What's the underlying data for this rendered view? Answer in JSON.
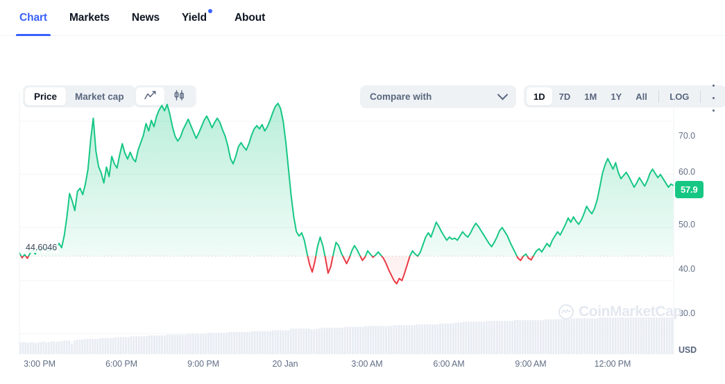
{
  "tabs": [
    {
      "label": "Chart",
      "active": true,
      "dot": false
    },
    {
      "label": "Markets",
      "active": false,
      "dot": false
    },
    {
      "label": "News",
      "active": false,
      "dot": false
    },
    {
      "label": "Yield",
      "active": false,
      "dot": true
    },
    {
      "label": "About",
      "active": false,
      "dot": false
    }
  ],
  "toolbar": {
    "metric": {
      "price": "Price",
      "market_cap": "Market cap",
      "selected": "Price"
    },
    "chart_type": {
      "line_icon": "line-chart-icon",
      "candle_icon": "candlestick-icon",
      "selected": "line"
    },
    "compare": {
      "label": "Compare with",
      "icon": "chevron-down-icon"
    },
    "ranges": [
      "1D",
      "7D",
      "1M",
      "1Y",
      "All"
    ],
    "range_selected": "1D",
    "log_label": "LOG",
    "more_icon": "ellipsis-icon"
  },
  "chart_data": {
    "type": "area",
    "title": "",
    "xlabel": "",
    "ylabel": "USD",
    "currency": "USD",
    "ylim": [
      26.0,
      75.5
    ],
    "yticks": [
      70.0,
      60.0,
      50.0,
      40.0,
      30.0
    ],
    "ytick_labels": [
      "70.0",
      "60.0",
      "50.0",
      "40.0",
      "30.0"
    ],
    "xtick_labels": [
      "3:00 PM",
      "6:00 PM",
      "9:00 PM",
      "20 Jan",
      "3:00 AM",
      "6:00 AM",
      "9:00 AM",
      "12:00 PM"
    ],
    "grid": true,
    "legend": null,
    "reference_line": {
      "value": 44.6046,
      "label": "44.6046",
      "style": "dotted"
    },
    "current_price": {
      "value": 57.9,
      "label": "57.9",
      "color": "#16c784"
    },
    "line_color_up": "#16c784",
    "line_color_down": "#ea3943",
    "watermark": "CoinMarketCap",
    "series": [
      {
        "name": "Price",
        "values": [
          45.2,
          44.3,
          44.9,
          44.2,
          45.1,
          45.8,
          45.0,
          46.2,
          45.4,
          46.4,
          45.9,
          45.5,
          46.1,
          45.7,
          46.3,
          47.0,
          46.2,
          48.5,
          52.0,
          56.4,
          55.0,
          53.2,
          56.8,
          57.4,
          56.2,
          58.2,
          61.0,
          66.5,
          70.6,
          64.4,
          61.5,
          60.3,
          58.4,
          61.4,
          59.6,
          63.4,
          62.0,
          61.2,
          63.7,
          65.8,
          64.0,
          62.9,
          64.2,
          63.0,
          62.4,
          64.6,
          66.0,
          67.4,
          69.6,
          68.2,
          70.2,
          69.0,
          71.0,
          72.2,
          73.0,
          72.0,
          73.2,
          71.4,
          69.0,
          67.2,
          66.3,
          67.0,
          68.4,
          69.4,
          70.4,
          69.2,
          68.0,
          66.8,
          67.8,
          69.0,
          70.2,
          71.0,
          70.0,
          68.8,
          69.8,
          70.6,
          69.8,
          68.4,
          67.2,
          65.4,
          63.0,
          62.0,
          63.4,
          65.2,
          66.0,
          65.2,
          64.6,
          65.8,
          67.4,
          68.6,
          69.2,
          68.6,
          69.4,
          68.2,
          69.0,
          70.2,
          71.6,
          72.8,
          73.4,
          72.4,
          70.0,
          66.0,
          61.0,
          56.0,
          52.0,
          49.2,
          48.4,
          49.0,
          47.6,
          45.2,
          43.0,
          41.6,
          43.6,
          46.4,
          48.2,
          46.6,
          44.2,
          41.4,
          42.6,
          45.0,
          47.2,
          46.6,
          45.2,
          44.2,
          43.2,
          44.2,
          45.6,
          46.6,
          45.8,
          44.8,
          43.8,
          44.4,
          45.6,
          45.0,
          44.4,
          44.8,
          45.4,
          44.8,
          44.2,
          43.2,
          42.0,
          41.0,
          40.0,
          39.4,
          40.4,
          40.0,
          41.4,
          43.0,
          44.6,
          45.6,
          45.0,
          44.6,
          45.4,
          46.8,
          48.2,
          49.0,
          48.2,
          49.6,
          51.0,
          50.2,
          49.2,
          48.4,
          47.6,
          48.2,
          47.8,
          48.0,
          47.6,
          48.4,
          49.2,
          48.6,
          48.2,
          49.0,
          50.0,
          50.8,
          50.2,
          49.4,
          48.6,
          47.8,
          47.0,
          46.4,
          47.2,
          48.2,
          49.4,
          50.0,
          49.2,
          48.4,
          47.2,
          46.2,
          45.2,
          44.2,
          43.8,
          44.6,
          45.0,
          44.2,
          43.9,
          44.8,
          45.6,
          46.0,
          45.4,
          46.2,
          47.0,
          46.4,
          47.6,
          48.4,
          49.2,
          48.6,
          49.6,
          50.6,
          51.8,
          51.0,
          52.0,
          51.2,
          50.6,
          51.4,
          52.6,
          54.0,
          53.2,
          52.6,
          53.6,
          55.2,
          57.6,
          60.2,
          61.8,
          63.0,
          62.0,
          61.0,
          62.2,
          60.4,
          59.2,
          59.8,
          60.4,
          59.6,
          58.6,
          57.6,
          58.4,
          59.4,
          58.6,
          57.8,
          58.8,
          60.2,
          61.0,
          60.2,
          59.4,
          60.0,
          59.2,
          58.4,
          57.6,
          58.2,
          57.9
        ]
      }
    ],
    "volume": {
      "name": "Volume",
      "color": "#e8ecf3",
      "values": [
        14,
        14,
        14,
        13,
        14,
        14,
        13,
        14,
        14,
        15,
        14,
        14,
        15,
        15,
        14,
        15,
        15,
        16,
        16,
        16,
        12,
        16,
        17,
        17,
        17,
        18,
        18,
        18,
        18,
        18,
        18,
        19,
        19,
        19,
        19,
        19,
        19,
        20,
        20,
        20,
        20,
        20,
        20,
        21,
        21,
        21,
        21,
        21,
        21,
        21,
        22,
        22,
        22,
        22,
        22,
        22,
        22,
        23,
        23,
        23,
        23,
        23,
        23,
        23,
        23,
        24,
        24,
        24,
        24,
        24,
        24,
        24,
        24,
        25,
        25,
        25,
        25,
        25,
        25,
        25,
        25,
        26,
        26,
        26,
        26,
        26,
        26,
        26,
        26,
        26,
        27,
        27,
        27,
        27,
        27,
        27,
        27,
        27,
        28,
        28,
        28,
        28,
        28,
        28,
        28,
        30,
        30,
        30,
        30,
        30,
        30,
        30,
        30,
        29,
        29,
        30,
        30,
        31,
        31,
        31,
        31,
        31,
        31,
        31,
        31,
        31,
        32,
        32,
        32,
        32,
        32,
        32,
        32,
        32,
        33,
        33,
        33,
        33,
        33,
        33,
        33,
        33,
        33,
        33,
        33,
        34,
        34,
        34,
        34,
        34,
        34,
        34,
        34,
        34,
        35,
        35,
        35,
        35,
        35,
        35,
        35,
        35,
        35,
        36,
        36,
        36,
        36,
        36,
        36,
        37,
        37,
        37,
        38,
        38,
        38,
        38,
        38,
        38,
        38,
        38,
        38,
        39,
        39,
        39,
        39,
        39,
        39,
        39,
        39,
        39,
        39,
        39,
        40,
        40,
        40,
        40,
        40,
        40,
        40,
        40,
        40,
        40,
        40,
        40,
        41,
        41,
        41,
        41,
        41,
        41,
        41,
        41,
        41,
        41,
        42,
        42,
        42,
        42,
        42,
        42,
        42,
        42,
        42,
        42,
        42,
        43,
        43,
        43,
        43,
        43,
        43,
        43,
        43,
        43,
        43,
        43,
        43,
        43,
        43,
        43,
        43,
        43,
        43,
        43,
        43,
        43,
        43,
        43,
        43,
        43,
        43,
        43,
        43,
        43
      ]
    }
  }
}
